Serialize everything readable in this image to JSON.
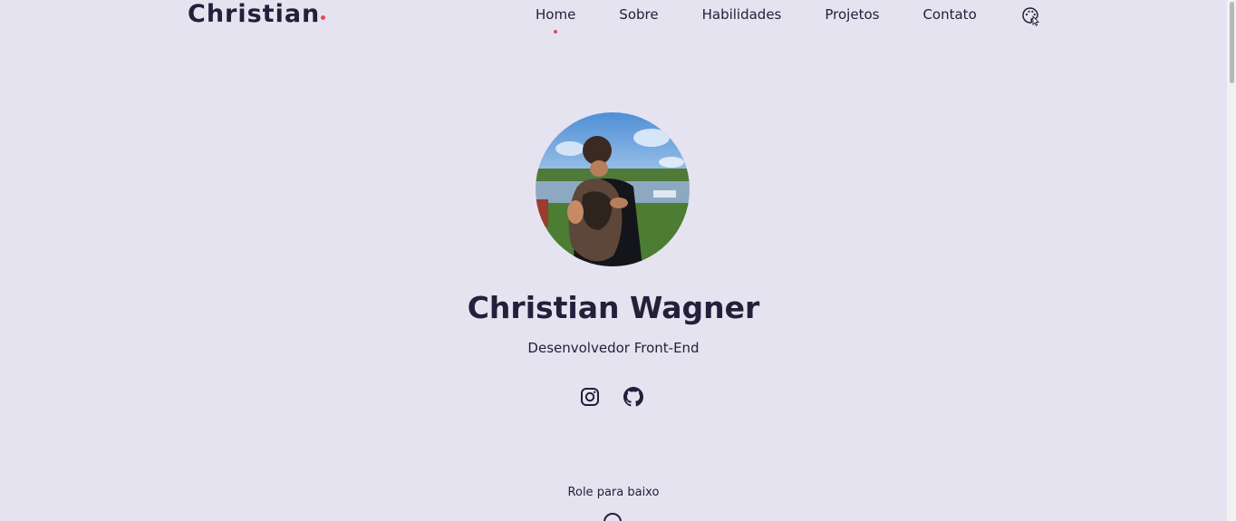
{
  "header": {
    "logo": "Christian",
    "nav": [
      {
        "label": "Home",
        "active": true
      },
      {
        "label": "Sobre",
        "active": false
      },
      {
        "label": "Habilidades",
        "active": false
      },
      {
        "label": "Projetos",
        "active": false
      },
      {
        "label": "Contato",
        "active": false
      }
    ],
    "theme_icon": "palette-icon"
  },
  "hero": {
    "name": "Christian Wagner",
    "subtitle": "Desenvolvedor Front-End",
    "socials": [
      {
        "icon": "instagram-icon"
      },
      {
        "icon": "github-icon"
      }
    ],
    "scroll_label": "Role para baixo",
    "scroll_icon": "mouse-icon"
  },
  "colors": {
    "background": "#e6e3f0",
    "text": "#22203a",
    "accent": "#e04b5a"
  }
}
